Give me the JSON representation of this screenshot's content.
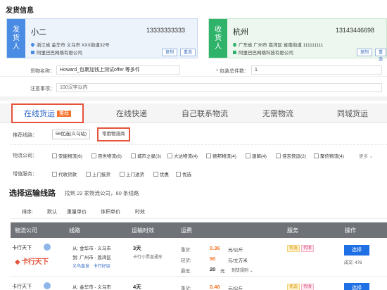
{
  "page": {
    "title": "发货信息"
  },
  "sender": {
    "tag": "发货人",
    "name": "小二",
    "phone": "13333333333",
    "address": "浙江省 金华市 义乌市 XXX街道32号",
    "company": "阿里巴巴网络有限公司",
    "copy_label": "复制",
    "reselect_label": "重选"
  },
  "receiver": {
    "tag": "收货人",
    "name": "杭州",
    "phone": "13143446698",
    "address": "广东省 广州市 荔湾区 省南街道 111111111",
    "company": "阿里巴巴网络科技有限公司",
    "copy_label": "复制",
    "reselect_label": "重选"
  },
  "goods": {
    "name_label": "货物名称：",
    "name_value": "Howard_包裹加钱上测试offer 等多件",
    "count_label": "* 包装总件数：",
    "count_value": "1",
    "notes_label": "注意事项：",
    "notes_placeholder": "100汉字以内"
  },
  "tabs": [
    {
      "label": "在线货运",
      "badge": "推荐"
    },
    {
      "label": "在线快递"
    },
    {
      "label": "自己联系物流"
    },
    {
      "label": "无需物流"
    },
    {
      "label": "同城货运"
    }
  ],
  "filters": {
    "route_label": "推荐线路：",
    "route_chip": "56优选(义乌站)",
    "common_chip": "常用物流商",
    "company_label": "物流公司：",
    "companies": [
      "安能物流(6)",
      "百世物流(6)",
      "城市之星(3)",
      "大达物流(4)",
      "德邦物流(4)",
      "速邮(4)",
      "佳吉快运(2)",
      "聚信物流(4)"
    ],
    "more_label": "更多",
    "service_label": "增值服务：",
    "services": [
      "代收货款",
      "上门接货",
      "上门送货",
      "优惠",
      "优选"
    ]
  },
  "results": {
    "title": "选择运输线路",
    "summary": "找到 22 家物流公司，60 条线路"
  },
  "sort": {
    "label": "排序:",
    "options": [
      "默认",
      "重量单价",
      "体积单价",
      "时效"
    ]
  },
  "table": {
    "headers": [
      "物流公司",
      "线路",
      "运输时效",
      "运费",
      "服务",
      "操作"
    ],
    "rows": [
      {
        "company": "卡行天下",
        "from": "从: 金华市 - 义乌市",
        "to": "到: 广州市 - 荔湾区",
        "route_note": "义乌直发",
        "route_note2": "卡行好运",
        "days": "3天",
        "days_note": "卡行小票直通车",
        "weight_label": "重货:",
        "weight_price": "0.36",
        "weight_unit": "元/公斤",
        "light_label": "轻货:",
        "light_price": "90",
        "light_unit": "元/立方米",
        "min_label": "最低:",
        "min_price": "20",
        "min_unit": "元",
        "rule_label": "到货规则",
        "service_tags": [
          "优选",
          "代收"
        ],
        "select_label": "选择",
        "deals": "成交: 476"
      },
      {
        "company": "卡行天下",
        "from": "从: 金华市 - 义乌市",
        "to": "",
        "route_note": "",
        "route_note2": "",
        "days": "4天",
        "days_note": "",
        "weight_label": "重货:",
        "weight_price": "0.46",
        "weight_unit": "元/公斤",
        "service_tags": [
          "优选",
          "代收"
        ],
        "select_label": "选择"
      }
    ]
  },
  "colors": {
    "accent": "#1f6fe5",
    "highlight": "#e4533a",
    "price": "#f0772b",
    "header": "#6f7378"
  }
}
